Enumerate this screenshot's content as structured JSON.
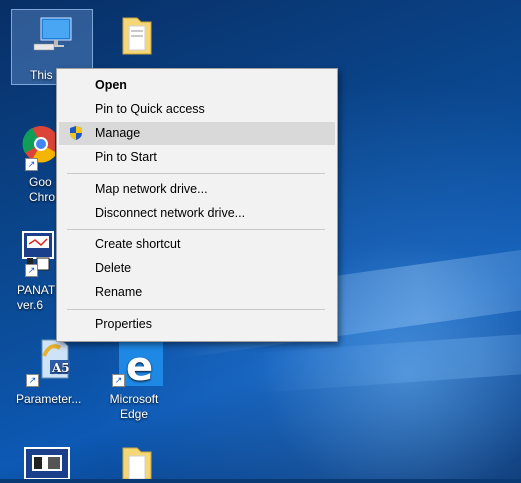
{
  "desktop": {
    "icons": [
      {
        "label": "This",
        "type": "this-pc"
      },
      {
        "label": "",
        "type": "folder"
      },
      {
        "label": "Goo\nChro",
        "type": "chrome"
      },
      {
        "label": "PANAT\nver.6",
        "type": "panat"
      },
      {
        "label": "Parameter...",
        "type": "parameter"
      },
      {
        "label": "Microsoft\nEdge",
        "type": "edge"
      },
      {
        "label": "",
        "type": "app"
      },
      {
        "label": "",
        "type": "folder"
      }
    ]
  },
  "context_menu": {
    "items": [
      {
        "label": "Open"
      },
      {
        "label": "Pin to Quick access"
      },
      {
        "label": "Manage",
        "icon": "shield-icon"
      },
      {
        "label": "Pin to Start"
      },
      {
        "label": "Map network drive..."
      },
      {
        "label": "Disconnect network drive..."
      },
      {
        "label": "Create shortcut"
      },
      {
        "label": "Delete"
      },
      {
        "label": "Rename"
      },
      {
        "label": "Properties"
      }
    ]
  },
  "colors": {
    "accent": "#1a56c5",
    "menu_bg": "#f2f2f2",
    "hover": "#d9d9d9"
  }
}
